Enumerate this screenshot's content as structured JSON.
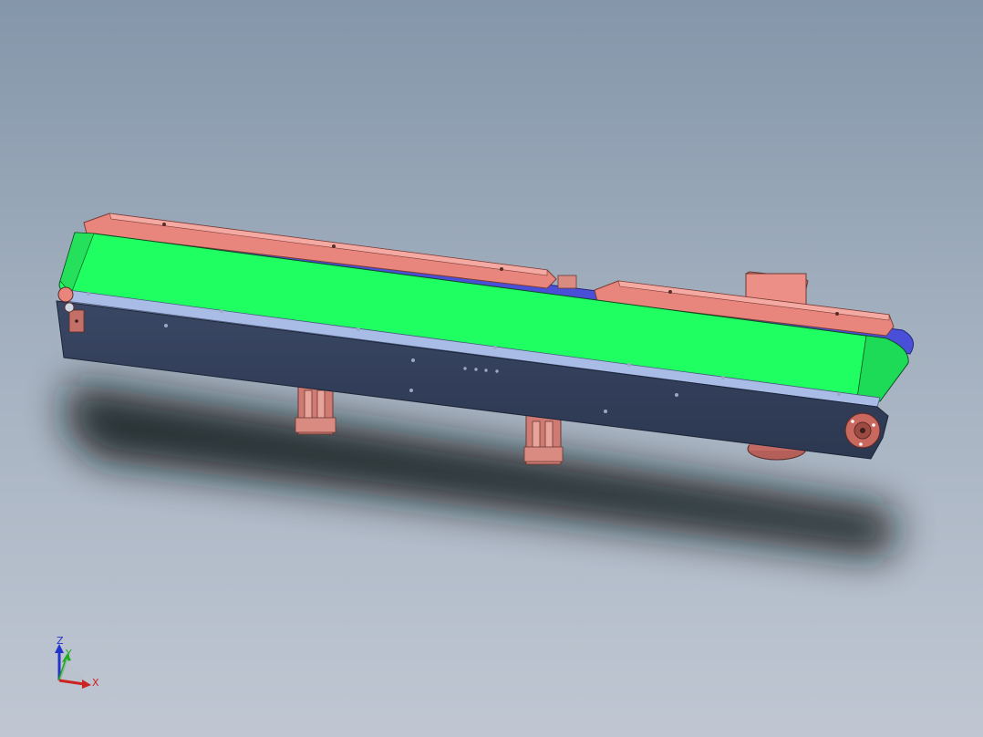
{
  "viewport": {
    "background_top": "#8496aa",
    "background_bottom": "#c0c7d3"
  },
  "model": {
    "belt_color": "#1fff62",
    "frame_color": "#333f5a",
    "frame_edge_color": "#a9bce6",
    "guide_rail_color": "#e8867d",
    "drive_color": "#e8867d",
    "return_belt_color": "#4a4fd8"
  },
  "triad": {
    "z_label": "Z",
    "y_label": "Y",
    "x_label": "X",
    "z_color": "#2233cc",
    "y_color": "#22aa22",
    "x_color": "#cc2222"
  }
}
